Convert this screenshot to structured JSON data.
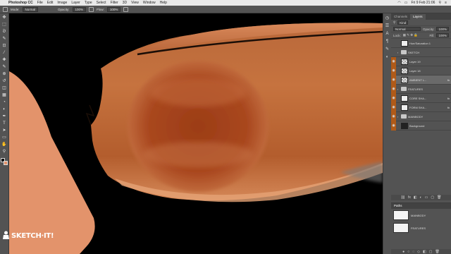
{
  "menubar": {
    "app_name": "Photoshop CC",
    "items": [
      "File",
      "Edit",
      "Image",
      "Layer",
      "Type",
      "Select",
      "Filter",
      "3D",
      "View",
      "Window",
      "Help"
    ],
    "clock": "Fri 9 Feb 21:06"
  },
  "options_bar": {
    "mode_label": "Mode:",
    "mode_value": "Normal",
    "opacity_label": "Opacity:",
    "opacity_value": "100%",
    "flow_label": "Flow:",
    "flow_value": "100%"
  },
  "tools": {
    "icons": [
      "move-icon",
      "marquee-icon",
      "lasso-icon",
      "quick-select-icon",
      "crop-icon",
      "eyedropper-icon",
      "healing-icon",
      "brush-icon",
      "clone-stamp-icon",
      "history-brush-icon",
      "eraser-icon",
      "gradient-icon",
      "blur-icon",
      "dodge-icon",
      "pen-icon",
      "type-icon",
      "path-select-icon",
      "shape-icon",
      "hand-icon",
      "zoom-icon"
    ],
    "glyphs": [
      "✥",
      "⬚",
      "ᘐ",
      "✎",
      "⊡",
      "⁄",
      "✚",
      "✎",
      "⊕",
      "↺",
      "◫",
      "▦",
      "◔",
      "◐",
      "✒",
      "T",
      "➤",
      "▭",
      "✋",
      "⚲"
    ]
  },
  "colors": {
    "foreground": "#000000",
    "background": "#e3936b",
    "shape_orange": "#e3936b",
    "body_orange": "#c8763f"
  },
  "dock_icons": [
    "history-icon",
    "properties-icon",
    "character-icon",
    "paragraph-icon",
    "brush-settings-icon",
    "adjustments-icon"
  ],
  "layers_panel": {
    "tabs": [
      "Channels",
      "Layers"
    ],
    "active_tab": "Layers",
    "filter_value": "Kind",
    "blend_mode": "Normal",
    "opacity_label": "Opacity:",
    "opacity_value": "100%",
    "lock_label": "Lock:",
    "fill_label": "Fill:",
    "fill_value": "100%",
    "layers": [
      {
        "name": "Hue/Saturation 1",
        "thumb": "fill-white",
        "visible": false,
        "group": false,
        "fx": false,
        "selected": false
      },
      {
        "name": "SKETCH",
        "thumb": "group",
        "visible": false,
        "group": true,
        "fx": false,
        "selected": false
      },
      {
        "name": "Layer 19",
        "thumb": "checker",
        "visible": true,
        "group": false,
        "fx": false,
        "selected": false
      },
      {
        "name": "Layer 18",
        "thumb": "checker",
        "visible": true,
        "group": false,
        "fx": false,
        "selected": false
      },
      {
        "name": "AMBIENT L...",
        "thumb": "checker",
        "visible": true,
        "group": false,
        "fx": true,
        "selected": true
      },
      {
        "name": "FEATURES",
        "thumb": "group",
        "visible": true,
        "group": true,
        "fx": false,
        "selected": false
      },
      {
        "name": "CORE SHA...",
        "thumb": "fill-white",
        "visible": true,
        "group": false,
        "fx": true,
        "selected": false
      },
      {
        "name": "FORM SHA...",
        "thumb": "fill-white",
        "visible": true,
        "group": false,
        "fx": true,
        "selected": false
      },
      {
        "name": "MAINBODY",
        "thumb": "group",
        "visible": true,
        "group": true,
        "fx": false,
        "selected": false
      },
      {
        "name": "Background",
        "thumb": "fill-dark",
        "visible": true,
        "group": false,
        "fx": false,
        "selected": false
      }
    ],
    "footer_icons": [
      "link-icon",
      "fx-icon",
      "mask-icon",
      "adjustment-icon",
      "folder-icon",
      "new-layer-icon",
      "trash-icon"
    ],
    "fx_glyph": "fx"
  },
  "paths_panel": {
    "title": "Paths",
    "paths": [
      {
        "name": "MAINBODY"
      },
      {
        "name": "FEATURES"
      }
    ],
    "footer_icons": [
      "fill-path-icon",
      "stroke-path-icon",
      "load-selection-icon",
      "make-path-icon",
      "add-mask-icon",
      "new-path-icon",
      "trash-icon"
    ]
  },
  "watermark": {
    "text": "SKETCH·IT!"
  }
}
